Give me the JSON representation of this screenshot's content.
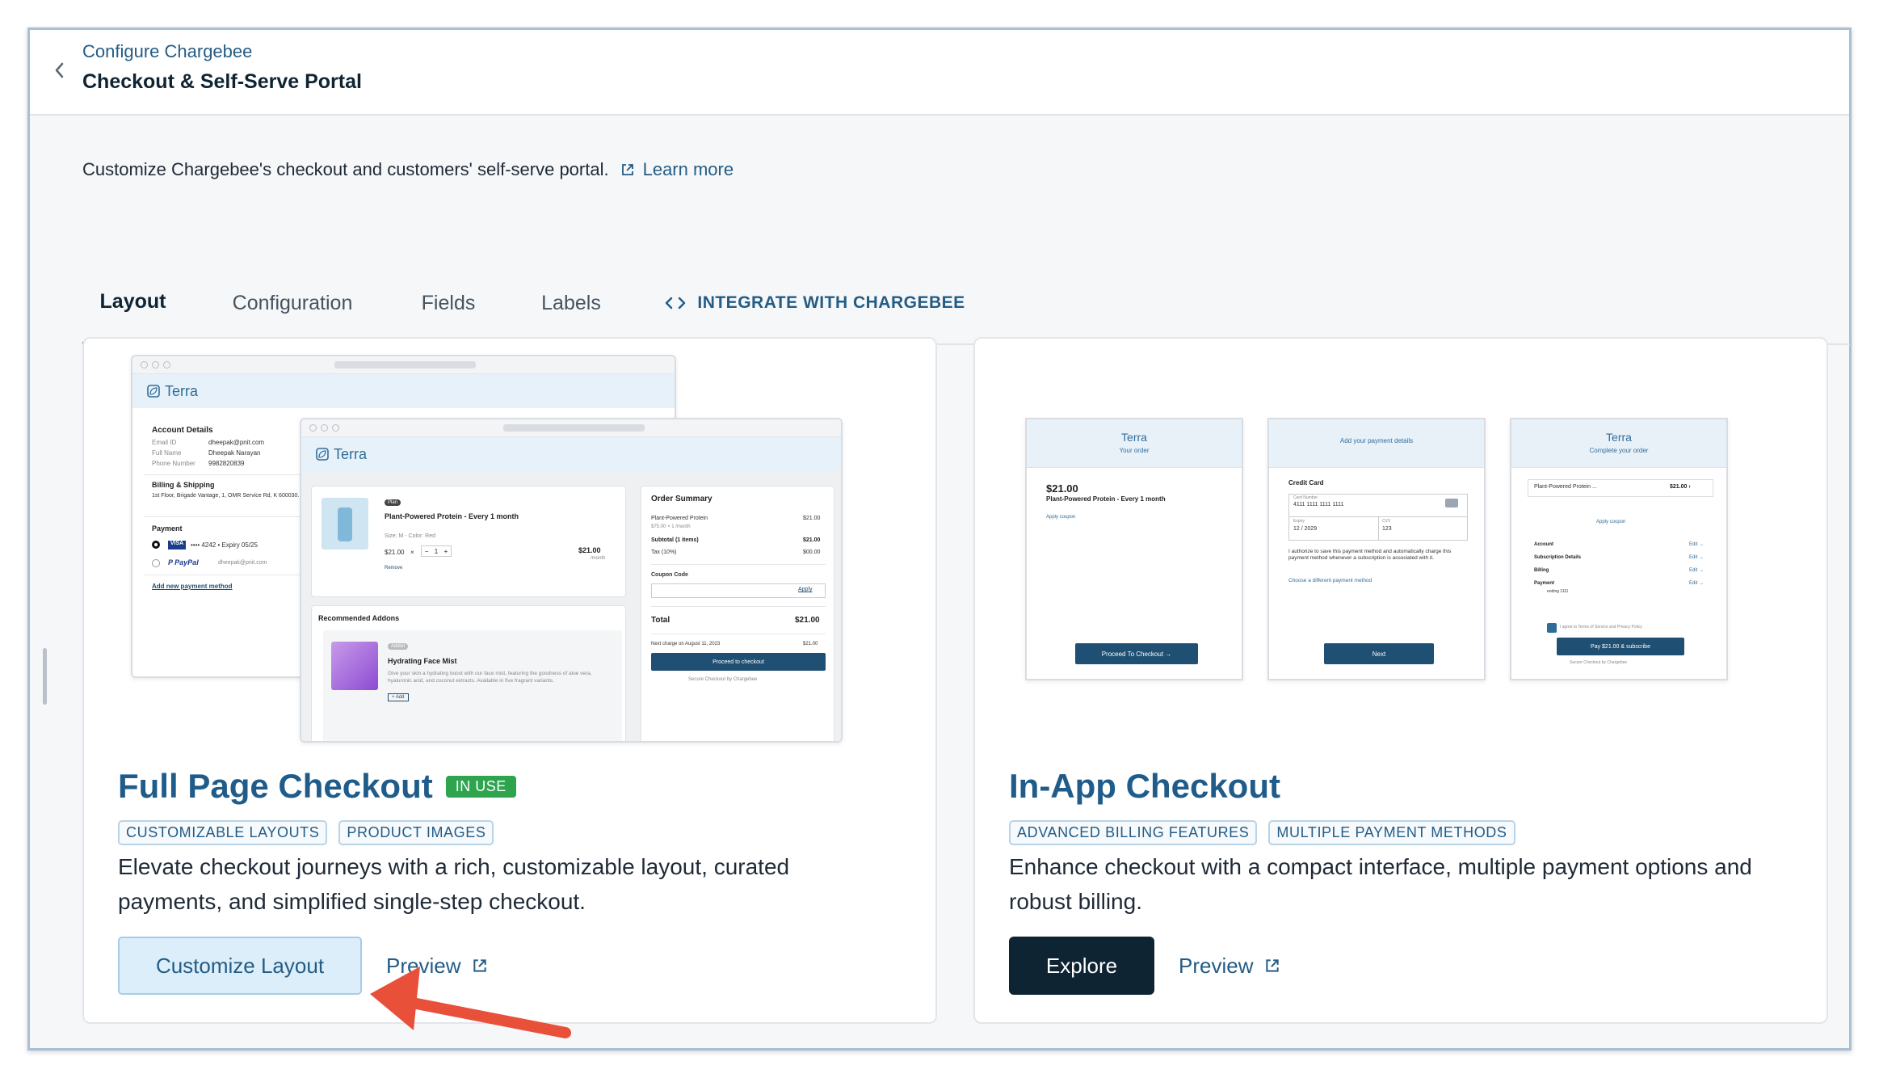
{
  "header": {
    "breadcrumb": "Configure Chargebee",
    "title": "Checkout & Self-Serve Portal"
  },
  "description": {
    "text": "Customize Chargebee's checkout and customers' self-serve portal.",
    "learn_more": "Learn more"
  },
  "tabs": [
    {
      "label": "Layout",
      "active": true
    },
    {
      "label": "Configuration",
      "active": false
    },
    {
      "label": "Fields",
      "active": false
    },
    {
      "label": "Labels",
      "active": false
    },
    {
      "label": "INTEGRATE WITH CHARGEBEE",
      "active": false
    }
  ],
  "cards": {
    "full_page": {
      "title": "Full Page Checkout",
      "badge": "IN USE",
      "chips": [
        "CUSTOMIZABLE LAYOUTS",
        "PRODUCT IMAGES"
      ],
      "text": "Elevate checkout journeys with a rich, customizable layout, curated payments, and simplified single-step checkout.",
      "primary_button": "Customize Layout",
      "preview": "Preview"
    },
    "in_app": {
      "title": "In-App Checkout",
      "chips": [
        "ADVANCED BILLING FEATURES",
        "MULTIPLE PAYMENT METHODS"
      ],
      "text": "Enhance checkout with a compact interface, multiple payment options and robust billing.",
      "primary_button": "Explore",
      "preview": "Preview"
    }
  },
  "full_page_mock": {
    "brand": "Terra",
    "account_details": "Account Details",
    "email_label": "Email ID",
    "email_value": "dheepak@pnit.com",
    "name_label": "Full Name",
    "name_value": "Dheepak Narayan",
    "phone_label": "Phone Number",
    "phone_value": "9982820839",
    "billing_title": "Billing & Shipping",
    "billing_address": "1st Floor, Brigade Vantage, 1, OMR Service Rd, K 600030.",
    "payment_title": "Payment",
    "card_text": "•••• 4242 • Expiry 05/25",
    "paypal_email": "dheepak@pnit.com",
    "add_payment": "Add new payment method",
    "plan_tag": "Plan",
    "product_name": "Plant-Powered Protein - Every 1 month",
    "product_variant": "Size: M - Color: Red",
    "unit_price": "$21.00",
    "qty": "1",
    "line_total": "$21.00",
    "per_month": "/month",
    "remove": "Remove",
    "order_summary": "Order Summary",
    "os_item": "Plant-Powered Protein",
    "os_item_price": "$21.00",
    "os_item_sub": "$75.00 × 1 /month",
    "subtotal_label": "Subtotal (1 items)",
    "subtotal_value": "$21.00",
    "tax_label": "Tax (10%)",
    "tax_value": "$00.00",
    "coupon_label": "Coupon Code",
    "apply": "Apply",
    "total_label": "Total",
    "total_value": "$21.00",
    "next_charge": "Next charge on August 11, 2023",
    "next_charge_value": "$21.00",
    "proceed": "Proceed to checkout",
    "secure": "Secure Checkout by Chargebee",
    "addons_title": "Recommended Addons",
    "addon_tag": "Addon",
    "addon_name": "Hydrating Face Mist",
    "addon_desc": "Give your skin a hydrating boost with our face mist, featuring the goodness of aloe vera, hyaluronic acid, and coconut extracts. Available in five fragrant variants.",
    "add": "+ Add"
  },
  "in_app_mock": {
    "brand": "Terra",
    "s1_sub": "Your order",
    "s1_price": "$21.00",
    "s1_product": "Plant-Powered Protein - Every 1 month",
    "s1_coupon": "Apply coupon",
    "s1_button": "Proceed To Checkout →",
    "s2_title": "Add your payment details",
    "s2_section": "Credit Card",
    "s2_card_label": "Card Number",
    "s2_card": "4111 1111 1111 1111",
    "s2_expiry_label": "Expiry",
    "s2_expiry": "12 / 2029",
    "s2_cvv_label": "CVV",
    "s2_cvv": "123",
    "s2_auth": "I authorize to save this payment method and automatically charge this payment method whenever a subscription is associated with it.",
    "s2_choose": "Choose a different payment method",
    "s2_button": "Next",
    "s3_sub": "Complete your order",
    "s3_product": "Plant-Powered Protein ...",
    "s3_price": "$21.00 ›",
    "s3_coupon": "Apply coupon",
    "s3_rows": [
      "Account",
      "Subscription Details",
      "Billing",
      "Payment"
    ],
    "s3_edit": "Edit →",
    "s3_payment_sub": "ending 1111",
    "s3_agree": "I agree to Terms of Service and Privacy Policy",
    "s3_button": "Pay $21.00 & subscribe",
    "s3_secure": "Secure Checkout by Chargebee"
  },
  "colors": {
    "accent": "#245c85",
    "title_blue": "#1f5c8a",
    "in_use_green": "#2ea44f",
    "dark_button": "#0f2433",
    "annotation_arrow": "#e8503a"
  }
}
